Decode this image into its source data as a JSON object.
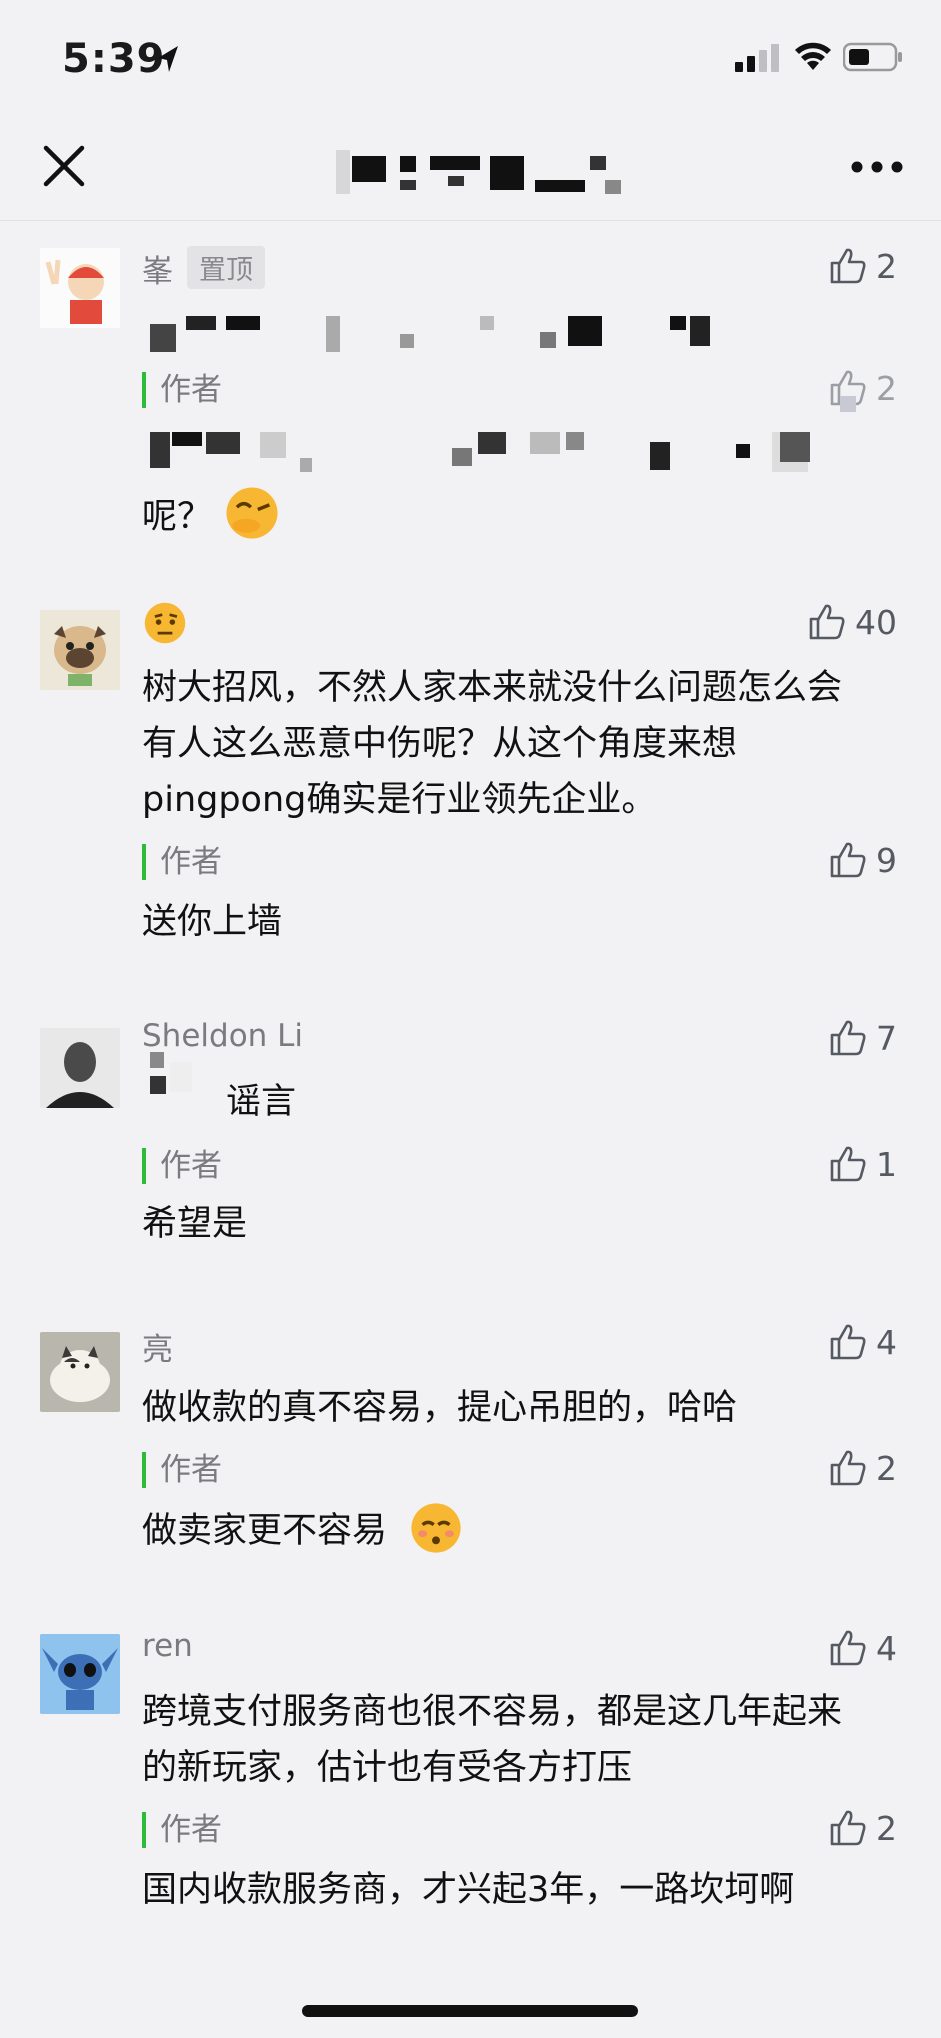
{
  "status": {
    "time": "5:39"
  },
  "comments": [
    {
      "name": "峯",
      "pin_label": "置顶",
      "likes": "2",
      "body": "",
      "reply": {
        "label": "作者",
        "likes": "2",
        "body": "呢？"
      }
    },
    {
      "name": "",
      "likes": "40",
      "body": "树大招风，不然人家本来就没什么问题怎么会有人这么恶意中伤呢？从这个角度来想pingpong确实是行业领先企业。",
      "reply": {
        "label": "作者",
        "likes": "9",
        "body": "送你上墙"
      }
    },
    {
      "name": "Sheldon Li",
      "likes": "7",
      "body": "谣言",
      "reply": {
        "label": "作者",
        "likes": "1",
        "body": "希望是"
      }
    },
    {
      "name": "亮",
      "likes": "4",
      "body": "做收款的真不容易，提心吊胆的，哈哈",
      "reply": {
        "label": "作者",
        "likes": "2",
        "body": "做卖家更不容易"
      }
    },
    {
      "name": "ren",
      "likes": "4",
      "body": "跨境支付服务商也很不容易，都是这几年起来的新玩家，估计也有受各方打压",
      "reply": {
        "label": "作者",
        "likes": "2",
        "body": "国内收款服务商，才兴起3年，一路坎坷啊"
      }
    }
  ],
  "icons": {
    "close": "close-icon",
    "more": "more-icon",
    "like": "thumbs-up-icon",
    "location": "location-arrow-icon",
    "signal": "signal-icon",
    "wifi": "wifi-icon",
    "battery": "battery-icon"
  },
  "colors": {
    "reply_bar": "#2dbb3a",
    "background": "#f2f2f4",
    "like": "#555a62"
  }
}
